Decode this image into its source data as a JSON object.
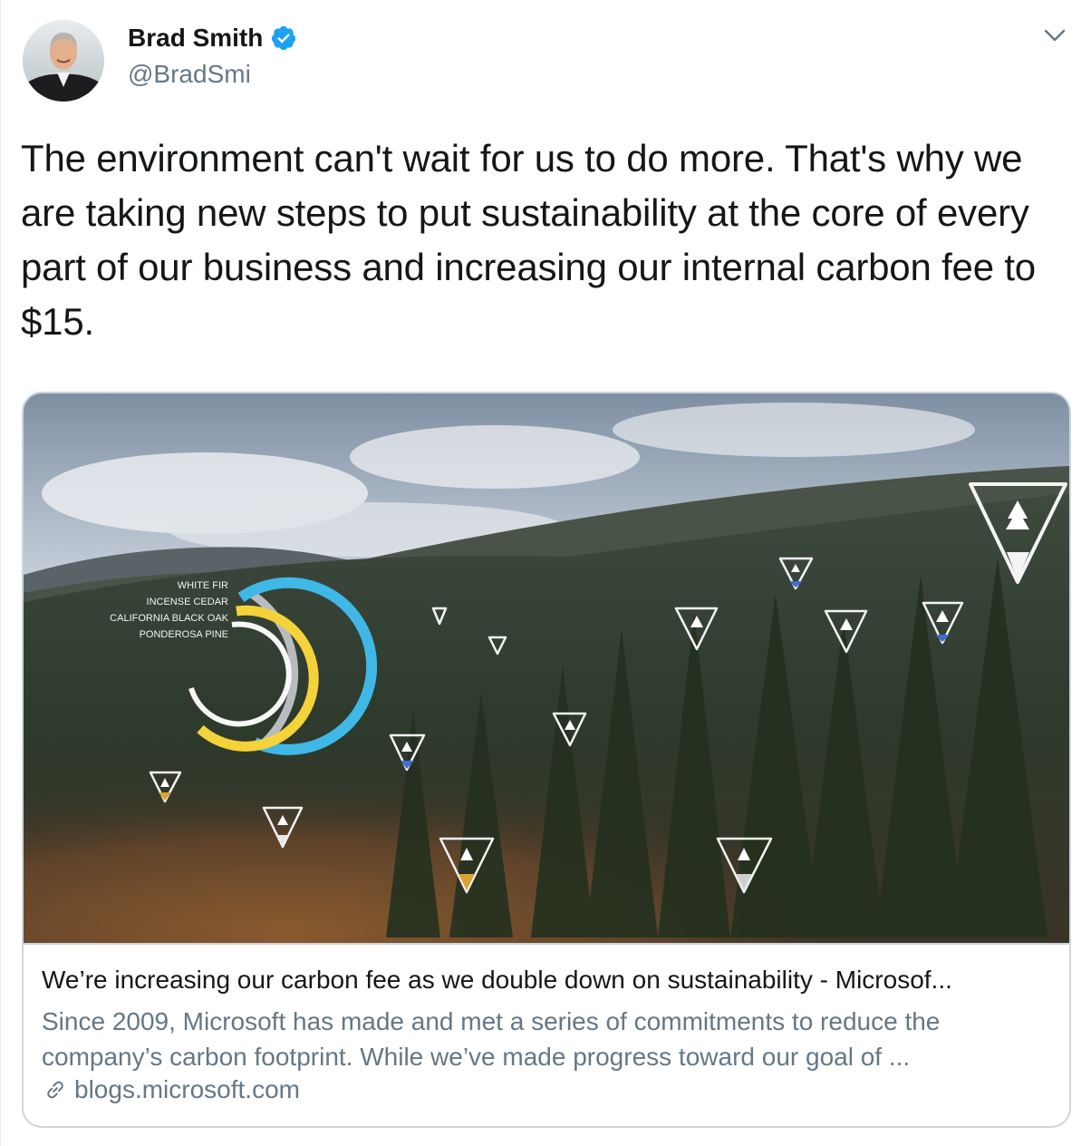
{
  "author": {
    "name": "Brad Smith",
    "handle": "@BradSmi",
    "verified": true
  },
  "tweet": {
    "text": "The environment can't wait for us to do more. That's why we are taking new steps to put sustainability at the core of every part of our business and increasing our internal carbon fee to $15."
  },
  "card": {
    "image_overlay_labels": [
      "WHITE FIR",
      "INCENSE CEDAR",
      "CALIFORNIA BLACK OAK",
      "PONDEROSA PINE"
    ],
    "title": "We’re increasing our carbon fee as we double down on sustainability - Microsof...",
    "description": "Since 2009, Microsoft has made and met a series of commitments to reduce the company’s carbon footprint. While we’ve made progress toward our goal of ...",
    "domain": "blogs.microsoft.com"
  },
  "icons": {
    "verified": "verified-badge-icon",
    "menu": "chevron-down-icon",
    "link": "link-icon"
  },
  "colors": {
    "text": "#14171a",
    "secondary": "#657786",
    "verified_blue": "#1da1f2",
    "border": "#ccd6dd"
  }
}
